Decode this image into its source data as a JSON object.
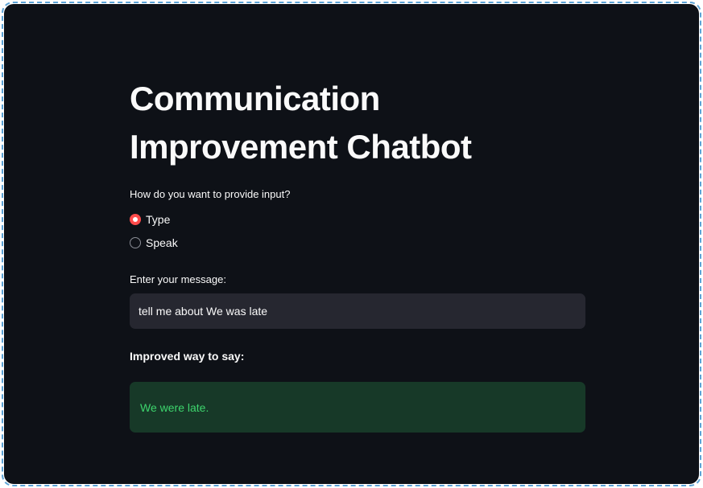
{
  "app": {
    "title": "Communication Improvement Chatbot"
  },
  "input_mode": {
    "label": "How do you want to provide input?",
    "options": [
      {
        "label": "Type",
        "selected": true
      },
      {
        "label": "Speak",
        "selected": false
      }
    ]
  },
  "message": {
    "label": "Enter your message:",
    "value": "tell me about We was late"
  },
  "result": {
    "heading": "Improved way to say:",
    "text": "We were late."
  },
  "colors": {
    "background": "#0e1117",
    "accent": "#ff4b4b",
    "success_bg": "#173928",
    "success_text": "#3dd56d",
    "input_bg": "#262730"
  }
}
